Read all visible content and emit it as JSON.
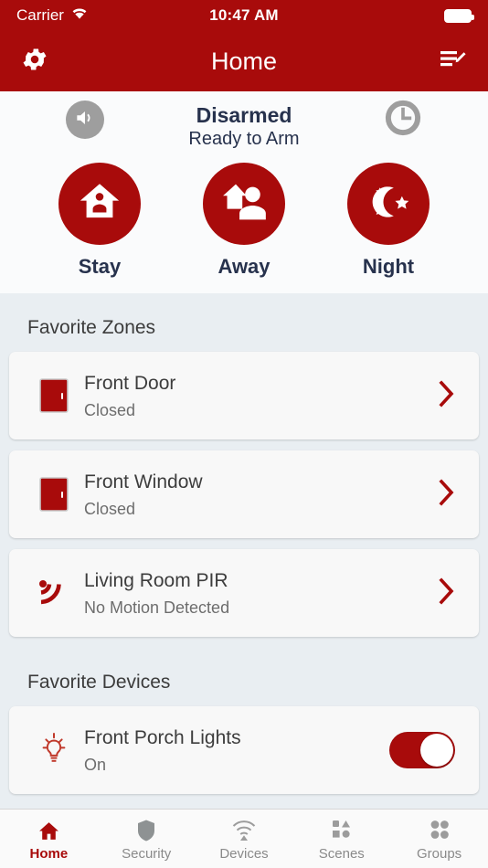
{
  "status_bar": {
    "carrier": "Carrier",
    "wifi_icon": "wifi-icon",
    "time": "10:47 AM",
    "battery_icon": "battery-full-icon"
  },
  "nav_bar": {
    "settings_icon": "gear-icon",
    "title": "Home",
    "edit_icon": "edit-list-icon"
  },
  "arm_panel": {
    "mute_icon": "speaker-icon",
    "history_icon": "clock-icon",
    "status": "Disarmed",
    "status_detail": "Ready to Arm",
    "modes": [
      {
        "label": "Stay",
        "icon": "house-person-icon"
      },
      {
        "label": "Away",
        "icon": "house-leave-person-icon"
      },
      {
        "label": "Night",
        "icon": "moon-stars-icon"
      }
    ]
  },
  "zones": {
    "title": "Favorite Zones",
    "items": [
      {
        "name": "Front Door",
        "state": "Closed",
        "icon": "door-icon",
        "chevron": "chevron-right-icon"
      },
      {
        "name": "Front Window",
        "state": "Closed",
        "icon": "door-icon",
        "chevron": "chevron-right-icon"
      },
      {
        "name": "Living Room PIR",
        "state": "No Motion Detected",
        "icon": "motion-sensor-icon",
        "chevron": "chevron-right-icon"
      }
    ]
  },
  "devices": {
    "title": "Favorite Devices",
    "items": [
      {
        "name": "Front Porch Lights",
        "state": "On",
        "icon": "lightbulb-icon",
        "toggle_on": true
      }
    ]
  },
  "tab_bar": {
    "tabs": [
      {
        "label": "Home",
        "icon": "home-icon",
        "active": true
      },
      {
        "label": "Security",
        "icon": "shield-icon",
        "active": false
      },
      {
        "label": "Devices",
        "icon": "wifi-device-icon",
        "active": false
      },
      {
        "label": "Scenes",
        "icon": "scenes-shapes-icon",
        "active": false
      },
      {
        "label": "Groups",
        "icon": "groups-dots-icon",
        "active": false
      }
    ]
  },
  "colors": {
    "brand_red": "#a80b0b",
    "page_background": "#e9eef2",
    "card_background": "#f8f8f8",
    "status_text": "#27324d",
    "inactive_gray": "#9e9e9e"
  }
}
